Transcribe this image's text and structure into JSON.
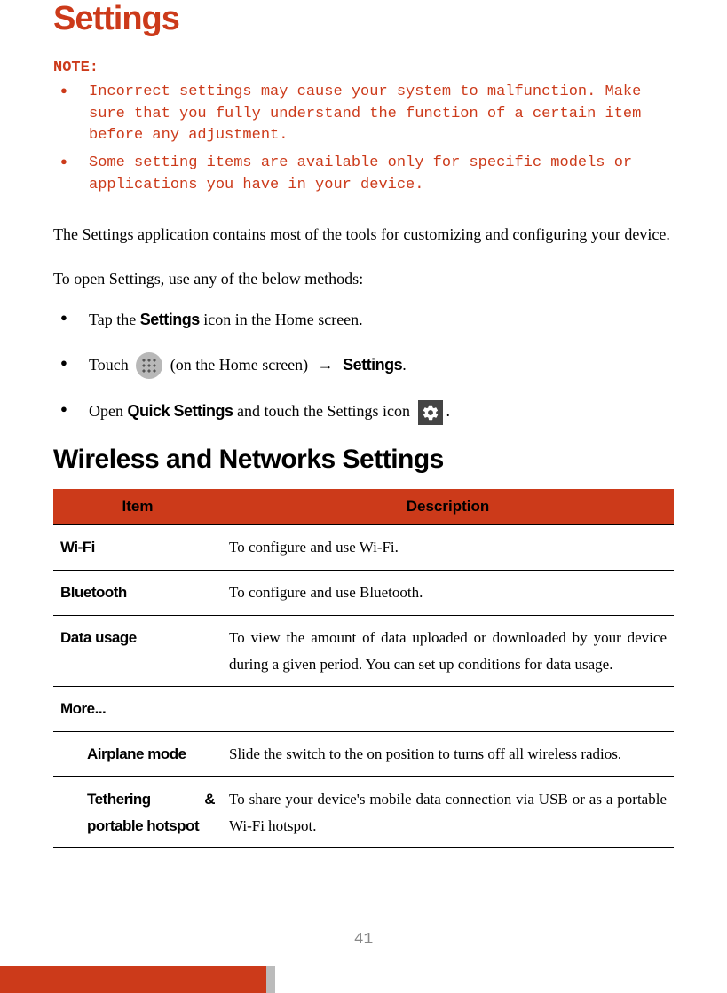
{
  "title": "Settings",
  "note_label": "NOTE:",
  "notes": [
    "Incorrect settings may cause your system to malfunction. Make sure that you fully understand the function of a certain item before any adjustment.",
    "Some setting items are available only for specific models or applications you have in your device."
  ],
  "intro": "The Settings application contains most of the tools for customizing and configuring your device.",
  "open_methods_intro": "To open Settings, use any of the below methods:",
  "methods": {
    "m1_pre": "Tap the ",
    "m1_bold": "Settings",
    "m1_post": " icon in the Home screen.",
    "m2_pre": "Touch ",
    "m2_mid": " (on the Home screen) ",
    "m2_bold": "Settings",
    "m2_end": ".",
    "m3_pre": "Open ",
    "m3_bold": "Quick Settings",
    "m3_mid": " and touch the Settings icon ",
    "m3_end": "."
  },
  "section_heading": "Wireless and Networks Settings",
  "table": {
    "header_item": "Item",
    "header_desc": "Description",
    "rows": [
      {
        "item": "Wi-Fi",
        "desc": "To configure and use Wi-Fi."
      },
      {
        "item": "Bluetooth",
        "desc": "To configure and use Bluetooth."
      },
      {
        "item": "Data usage",
        "desc": "To view the amount of data uploaded or downloaded by your device during a given period. You can set up conditions for data usage."
      },
      {
        "item": "More...",
        "desc": ""
      },
      {
        "item": "Airplane mode",
        "desc": "Slide the switch to the on position to turns off all wireless radios."
      },
      {
        "item": "Tethering & portable hotspot",
        "desc": "To share your device's mobile data connection via USB or as a portable Wi-Fi hotspot."
      }
    ]
  },
  "page_number": "41"
}
